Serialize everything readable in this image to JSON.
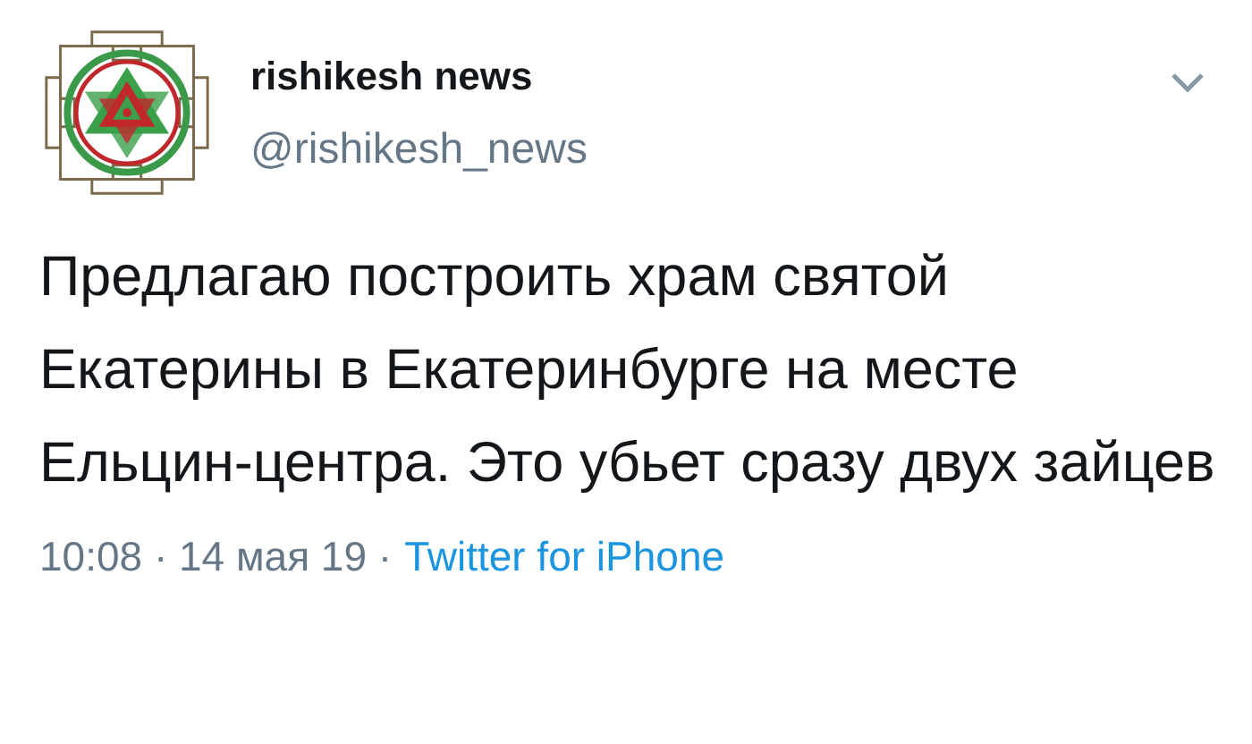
{
  "tweet": {
    "author": {
      "name": "rishikesh news",
      "handle": "@rishikesh_news"
    },
    "text": "Предлагаю построить храм святой Екатерины в Екатеринбурге на месте Ельцин-центра. Это убьет сразу двух зайцев",
    "meta": "10:08 · 14 мая 19 ·",
    "source": "Twitter for iPhone"
  }
}
